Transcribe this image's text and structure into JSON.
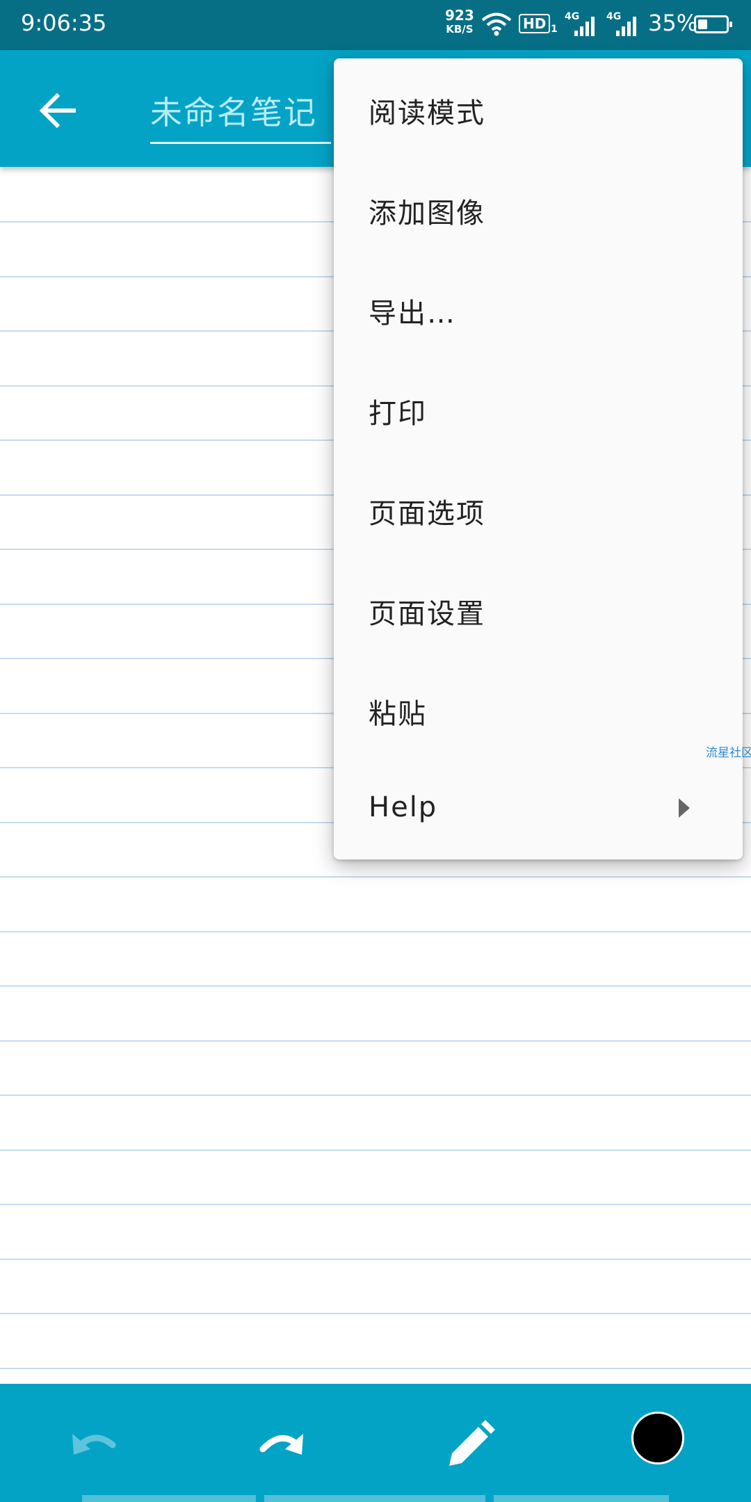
{
  "status_bar": {
    "time": "9:06:35",
    "net_speed": "923",
    "net_speed_unit": "KB/S",
    "hd_label": "HD",
    "hd_sub": "1",
    "signal_label_1": "4G",
    "signal_label_2": "4G",
    "battery_percent": "35%",
    "battery_level": 0.35
  },
  "app_bar": {
    "title": "未命名笔记",
    "back_icon": "arrow-left-icon"
  },
  "menu": {
    "items": [
      {
        "label": "阅读模式"
      },
      {
        "label": "添加图像"
      },
      {
        "label": "导出…"
      },
      {
        "label": "打印"
      },
      {
        "label": "页面选项"
      },
      {
        "label": "页面设置"
      },
      {
        "label": "粘贴"
      },
      {
        "label": "Help",
        "has_submenu": true
      }
    ]
  },
  "watermark": "流星社区",
  "toolbar": {
    "undo_icon": "undo-icon",
    "redo_icon": "redo-icon",
    "pen_icon": "pencil-icon",
    "color_swatch": "#000000"
  },
  "colors": {
    "status_bar": "#066f86",
    "app_bar": "#03a3c6",
    "ruled_line": "#c5dbf2",
    "menu_bg": "#fafafa"
  }
}
